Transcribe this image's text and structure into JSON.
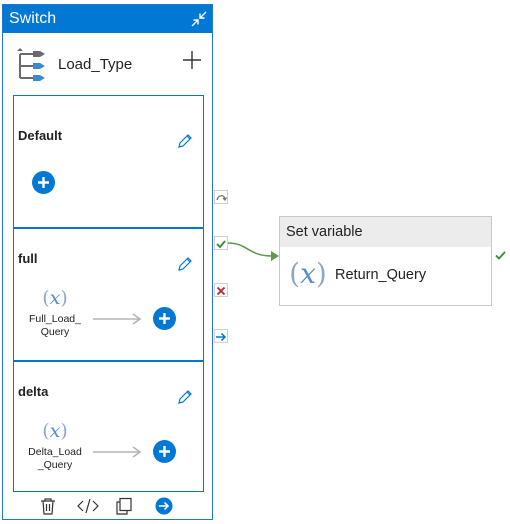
{
  "switch": {
    "header_title": "Switch",
    "activity_name": "Load_Type",
    "cases": [
      {
        "label": "Default"
      },
      {
        "label": "full",
        "activity_name_line1": "Full_Load_",
        "activity_name_line2": "Query"
      },
      {
        "label": "delta",
        "activity_name_line1": "Delta_Load",
        "activity_name_line2": "_Query"
      }
    ]
  },
  "set_variable": {
    "header_title": "Set variable",
    "activity_name": "Return_Query"
  },
  "icons": {
    "variable_symbol": "x",
    "paren_open": "(",
    "paren_close": ")"
  },
  "colors": {
    "accent": "#0078d4",
    "success": "#2e8b2e",
    "failure": "#c0262d",
    "connector": "#5c9a4a"
  }
}
